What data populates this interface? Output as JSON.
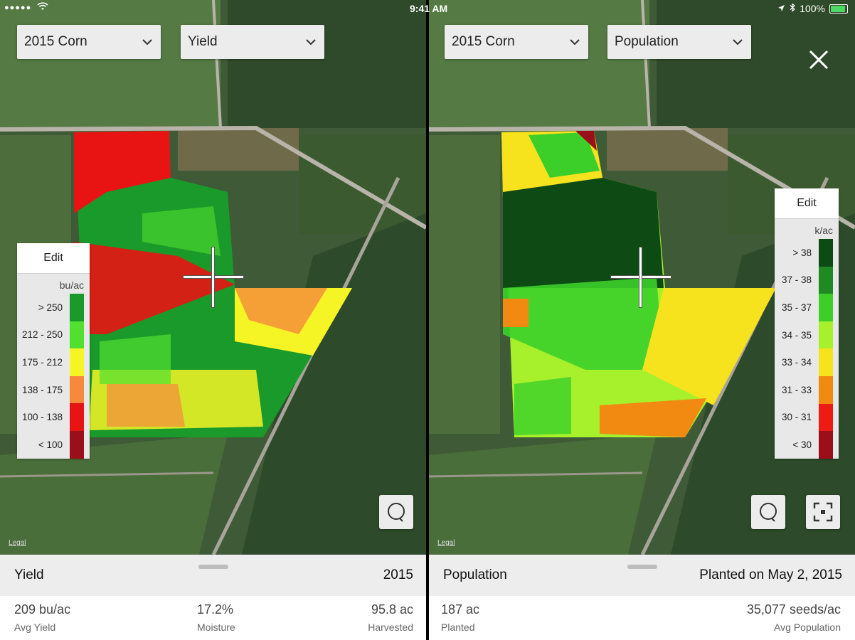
{
  "status_bar": {
    "signal": "●●●●●",
    "time": "9:41 AM",
    "battery": "100%"
  },
  "left": {
    "season_dropdown": "2015 Corn",
    "layer_dropdown": "Yield",
    "legend": {
      "edit_label": "Edit",
      "unit": "bu/ac",
      "rows": [
        {
          "label": "> 250",
          "color": "#1a9a2a"
        },
        {
          "label": "212 - 250",
          "color": "#52e030"
        },
        {
          "label": "175 - 212",
          "color": "#f5f526"
        },
        {
          "label": "138 - 175",
          "color": "#f58a3c"
        },
        {
          "label": "100 - 138",
          "color": "#e81414"
        },
        {
          "label": "< 100",
          "color": "#9a0f1a"
        }
      ]
    },
    "legal": "Legal",
    "panel": {
      "title": "Yield",
      "subtitle": "2015",
      "stats": [
        {
          "value": "209 bu/ac",
          "label": "Avg Yield"
        },
        {
          "value": "17.2%",
          "label": "Moisture"
        },
        {
          "value": "95.8 ac",
          "label": "Harvested"
        }
      ]
    }
  },
  "right": {
    "season_dropdown": "2015 Corn",
    "layer_dropdown": "Population",
    "legend": {
      "edit_label": "Edit",
      "unit": "k/ac",
      "rows": [
        {
          "label": "> 38",
          "color": "#0e4a14"
        },
        {
          "label": "37 - 38",
          "color": "#1f8a22"
        },
        {
          "label": "35 - 37",
          "color": "#3ccf2a"
        },
        {
          "label": "34 - 35",
          "color": "#a6f02c"
        },
        {
          "label": "33 - 34",
          "color": "#f7e21e"
        },
        {
          "label": "31 - 33",
          "color": "#f28a12"
        },
        {
          "label": "30 - 31",
          "color": "#ee1a14"
        },
        {
          "label": "< 30",
          "color": "#9a0f1a"
        }
      ]
    },
    "legal": "Legal",
    "panel": {
      "title": "Population",
      "subtitle": "Planted on May 2, 2015",
      "stats": [
        {
          "value": "187 ac",
          "label": "Planted"
        },
        {
          "value": "35,077 seeds/ac",
          "label": "Avg Population"
        }
      ]
    }
  }
}
